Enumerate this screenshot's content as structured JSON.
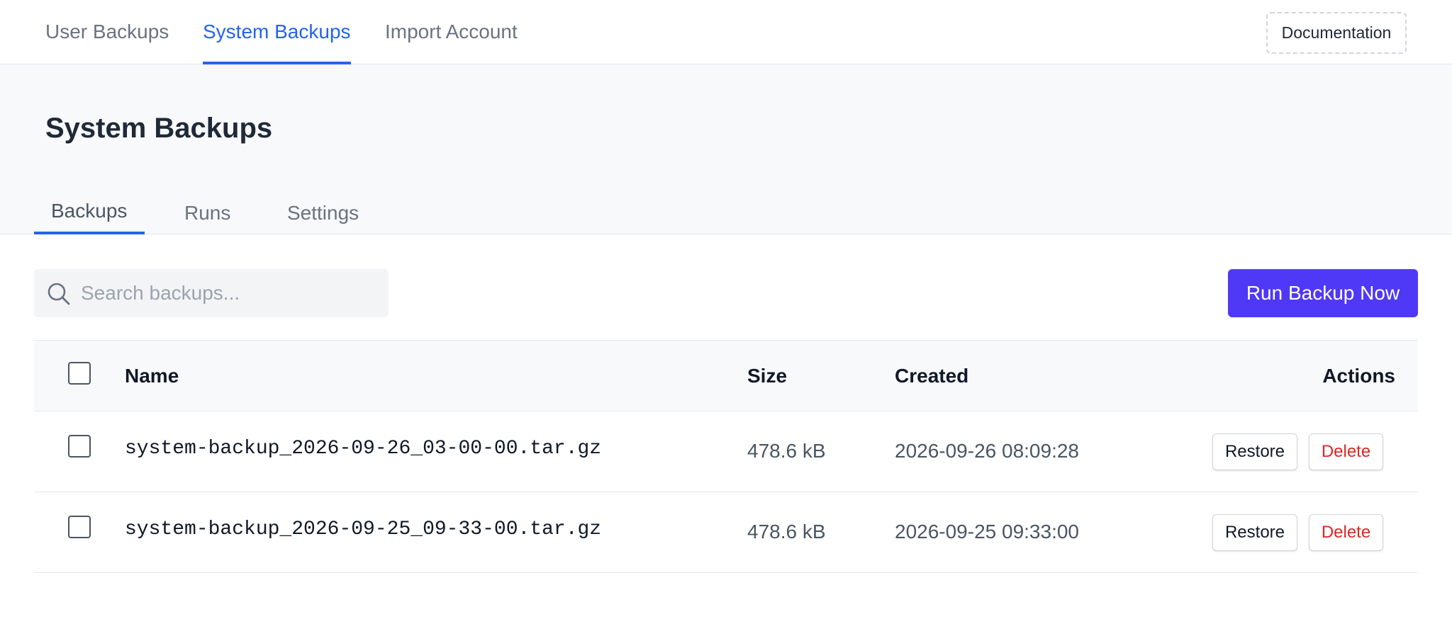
{
  "topnav": {
    "tabs": [
      {
        "label": "User Backups",
        "active": false
      },
      {
        "label": "System Backups",
        "active": true
      },
      {
        "label": "Import Account",
        "active": false
      }
    ],
    "documentation_label": "Documentation"
  },
  "page": {
    "title": "System Backups",
    "subtabs": [
      {
        "label": "Backups",
        "active": true
      },
      {
        "label": "Runs",
        "active": false
      },
      {
        "label": "Settings",
        "active": false
      }
    ]
  },
  "toolbar": {
    "search_placeholder": "Search backups...",
    "search_value": "",
    "run_button_label": "Run Backup Now"
  },
  "table": {
    "columns": {
      "name": "Name",
      "size": "Size",
      "created": "Created",
      "actions": "Actions"
    },
    "rows": [
      {
        "name": "system-backup_2026-09-26_03-00-00.tar.gz",
        "size": "478.6 kB",
        "created": "2026-09-26 08:09:28",
        "restore_label": "Restore",
        "delete_label": "Delete",
        "checked": false
      },
      {
        "name": "system-backup_2026-09-25_09-33-00.tar.gz",
        "size": "478.6 kB",
        "created": "2026-09-25 09:33:00",
        "restore_label": "Restore",
        "delete_label": "Delete",
        "checked": false
      }
    ]
  },
  "icons": {
    "search": "search-icon"
  },
  "colors": {
    "accent": "#2563eb",
    "primary_button": "#4f38f6",
    "danger": "#dc2626"
  }
}
